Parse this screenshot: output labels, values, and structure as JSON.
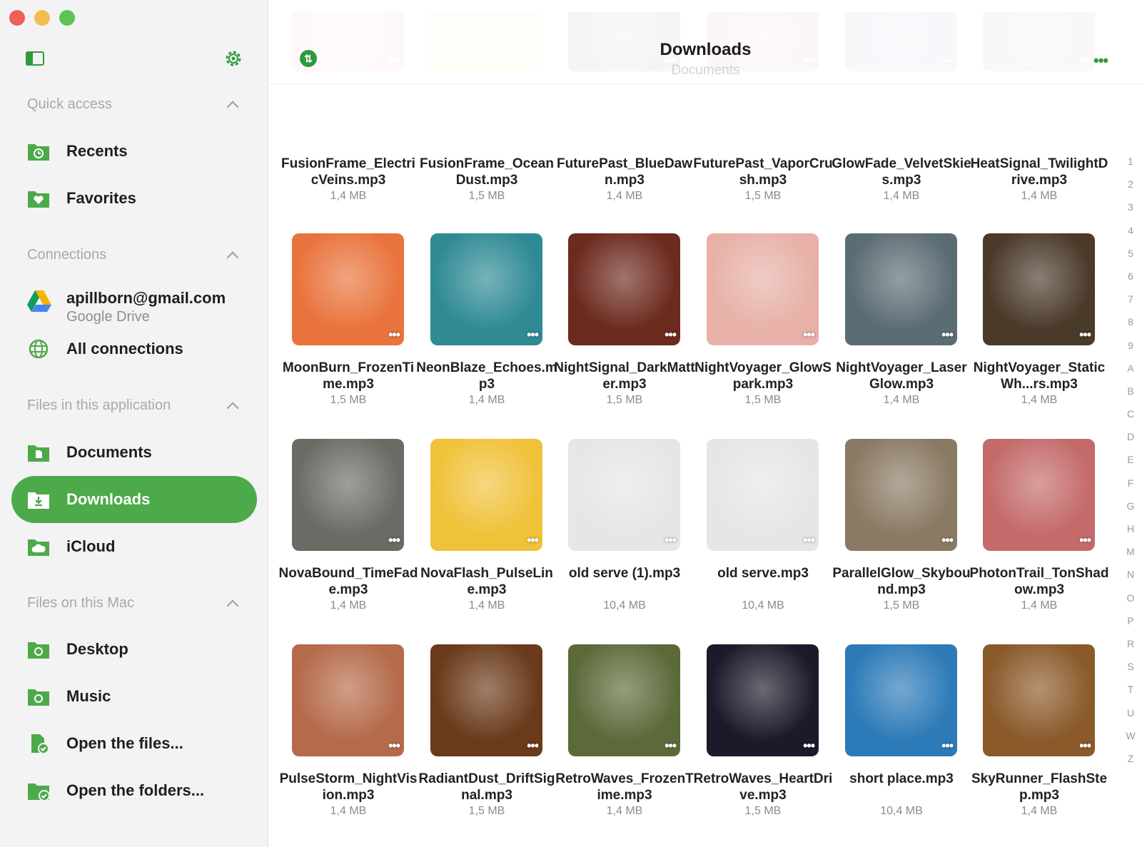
{
  "sidebar": {
    "sections": {
      "quick_access": "Quick access",
      "connections": "Connections",
      "files_app": "Files in this application",
      "files_mac": "Files on this Mac"
    },
    "items": {
      "recents": "Recents",
      "favorites": "Favorites",
      "all_connections": "All connections",
      "documents": "Documents",
      "downloads": "Downloads",
      "icloud": "iCloud",
      "desktop": "Desktop",
      "music": "Music",
      "open_files": "Open the files...",
      "open_folders": "Open the folders..."
    },
    "account": {
      "email": "apillborn@gmail.com",
      "service": "Google Drive"
    },
    "accent": "#4caa4a"
  },
  "header": {
    "title": "Downloads",
    "subtitle": "Documents"
  },
  "files": [
    {
      "name": "FusionFrame_ElectricVeins.mp3",
      "size": "1,4 MB",
      "color": "#e05a9c",
      "icon": "plant-pot"
    },
    {
      "name": "FusionFrame_OceanDust.mp3",
      "size": "1,5 MB",
      "color": "#f2c63c",
      "icon": "cartoon-character"
    },
    {
      "name": "FuturePast_BlueDawn.mp3",
      "size": "1,4 MB",
      "color": "#1a1414",
      "icon": "neon-sign"
    },
    {
      "name": "FuturePast_VaporCrush.mp3",
      "size": "1,5 MB",
      "color": "#b2333a",
      "icon": "boxing-gloves"
    },
    {
      "name": "GlowFade_VelvetSkies.mp3",
      "size": "1,4 MB",
      "color": "#254a8a",
      "icon": "light-bulb"
    },
    {
      "name": "HeatSignal_TwilightDrive.mp3",
      "size": "1,4 MB",
      "color": "#7a5232",
      "icon": "puppy"
    },
    {
      "name": "MoonBurn_FrozenTime.mp3",
      "size": "1,5 MB",
      "color": "#e9733c",
      "icon": "chinchilla"
    },
    {
      "name": "NeonBlaze_Echoes.mp3",
      "size": "1,4 MB",
      "color": "#2f8a94",
      "icon": "tv-head"
    },
    {
      "name": "NightSignal_DarkMatter.mp3",
      "size": "1,5 MB",
      "color": "#6d2a1f",
      "icon": "bearded-man"
    },
    {
      "name": "NightVoyager_GlowSpark.mp3",
      "size": "1,5 MB",
      "color": "#e7b1a7",
      "icon": "pink-hair"
    },
    {
      "name": "NightVoyager_LaserGlow.mp3",
      "size": "1,4 MB",
      "color": "#5c6c74",
      "icon": "cat-in-suit"
    },
    {
      "name": "NightVoyager_StaticWh...rs.mp3",
      "size": "1,4 MB",
      "color": "#4a3a2a",
      "icon": "rabbit-head"
    },
    {
      "name": "NovaBound_TimeFade.mp3",
      "size": "1,4 MB",
      "color": "#6b6b66",
      "icon": "money-dice"
    },
    {
      "name": "NovaFlash_PulseLine.mp3",
      "size": "1,4 MB",
      "color": "#f0c23a",
      "icon": "party-dog"
    },
    {
      "name": "old serve (1).mp3",
      "size": "10,4 MB",
      "color": "#e6e6e6",
      "icon": "woman-sketch"
    },
    {
      "name": "old serve.mp3",
      "size": "10,4 MB",
      "color": "#e6e6e6",
      "icon": "woman-sketch"
    },
    {
      "name": "ParallelGlow_Skybound.mp3",
      "size": "1,5 MB",
      "color": "#8a7a64",
      "icon": "office-sign"
    },
    {
      "name": "PhotonTrail_TonShadow.mp3",
      "size": "1,4 MB",
      "color": "#c46a6a",
      "icon": "robot"
    },
    {
      "name": "PulseStorm_NightVision.mp3",
      "size": "1,4 MB",
      "color": "#b56a4a",
      "icon": "face-glitter"
    },
    {
      "name": "RadiantDust_DriftSignal.mp3",
      "size": "1,5 MB",
      "color": "#6a3a1a",
      "icon": "leaf-face"
    },
    {
      "name": "RetroWaves_FrozenTime.mp3",
      "size": "1,4 MB",
      "color": "#5c6a3a",
      "icon": "astronaut-child"
    },
    {
      "name": "RetroWaves_HeartDrive.mp3",
      "size": "1,5 MB",
      "color": "#1a1a2a",
      "icon": "neon-swirls"
    },
    {
      "name": "short place.mp3",
      "size": "10,4 MB",
      "color": "#2c7ab8",
      "icon": "color-crush"
    },
    {
      "name": "SkyRunner_FlashStep.mp3",
      "size": "1,4 MB",
      "color": "#8a5a2a",
      "icon": "no-photo-sign"
    }
  ],
  "index_letters": [
    "1",
    "2",
    "3",
    "4",
    "5",
    "6",
    "7",
    "8",
    "9",
    "A",
    "B",
    "C",
    "D",
    "E",
    "F",
    "G",
    "H",
    "M",
    "N",
    "O",
    "P",
    "R",
    "S",
    "T",
    "U",
    "W",
    "Z"
  ]
}
